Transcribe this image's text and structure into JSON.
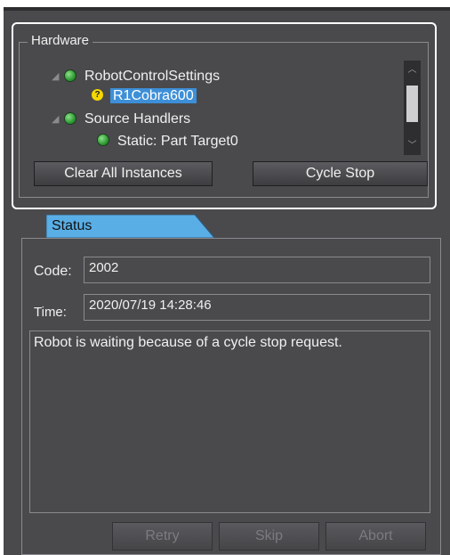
{
  "hardware": {
    "group_title": "Hardware",
    "tree": [
      {
        "label": "RobotControlSettings",
        "icon": "green-status-dot-icon"
      },
      {
        "label": "R1Cobra600",
        "icon": "question-warning-icon",
        "selected": true
      },
      {
        "label": "Source Handlers",
        "icon": "green-status-dot-icon"
      },
      {
        "label": "Static: Part Target0",
        "icon": "green-status-dot-icon"
      }
    ],
    "clear_button": "Clear All Instances",
    "cycle_stop_button": "Cycle Stop"
  },
  "status": {
    "tab_label": "Status",
    "code_label": "Code:",
    "code_value": "2002",
    "time_label": "Time:",
    "time_value": "2020/07/19 14:28:46",
    "message": "Robot is waiting because of a cycle stop request.",
    "buttons": {
      "retry": "Retry",
      "skip": "Skip",
      "abort": "Abort"
    }
  },
  "colors": {
    "panel_bg": "#4a4a4d",
    "tab_bg": "#5aaee6",
    "selection": "#3d8fd8",
    "status_ok": "#2e9b33",
    "status_warn": "#f5d800"
  }
}
